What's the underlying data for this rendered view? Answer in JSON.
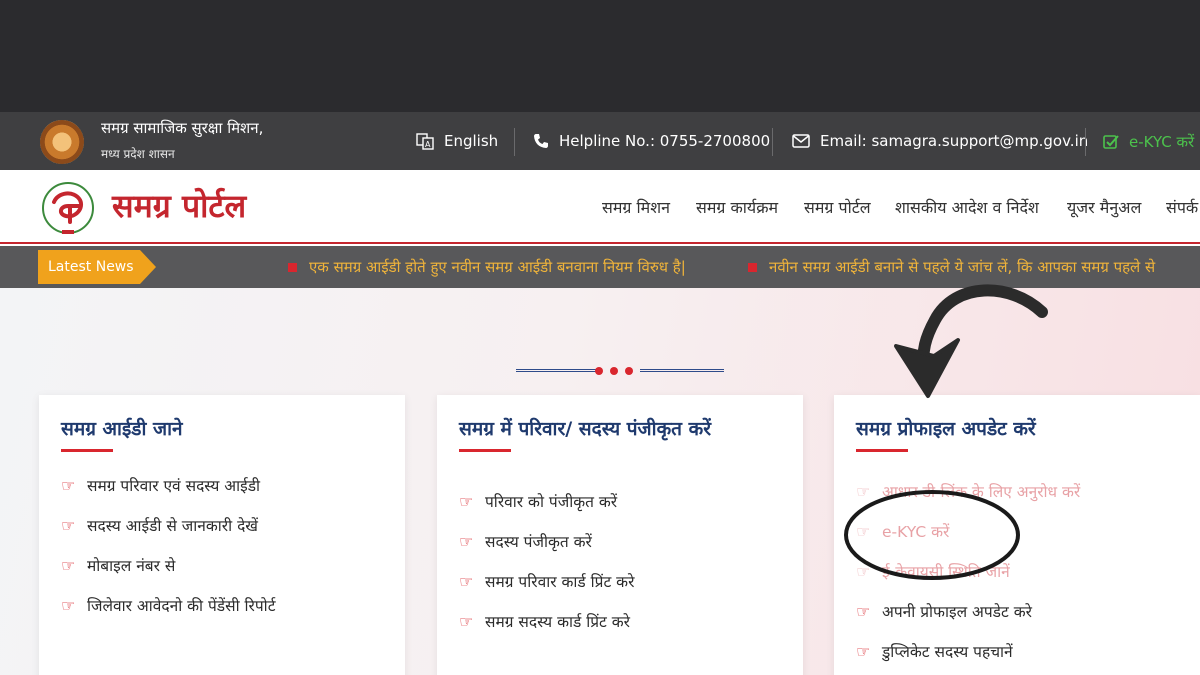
{
  "topbar": {
    "org_line1": "समग्र सामाजिक सुरक्षा मिशन,",
    "org_line2": "मध्य प्रदेश शासन",
    "language": "English",
    "helpline": "Helpline No.: 0755-2700800",
    "email": "Email: samagra.support@mp.gov.in",
    "ekyc": "e-KYC करें"
  },
  "header": {
    "brand": "समग्र पोर्टल",
    "nav": [
      "समग्र मिशन",
      "समग्र कार्यक्रम",
      "समग्र पोर्टल",
      "शासकीय आदेश व निर्देश",
      "यूजर मैनुअल",
      "संपर्क"
    ]
  },
  "ticker": {
    "label": "Latest News",
    "items": [
      "एक समग्र आईडी होते हुए नवीन समग्र आईडी बनवाना नियम विरुध है|",
      "नवीन समग्र आईडी बनाने से पहले ये जांच लें, कि आपका समग्र पहले से"
    ]
  },
  "cards": [
    {
      "title": "समग्र आईडी जाने",
      "items": [
        "समग्र परिवार एवं सदस्य आईडी",
        "सदस्य आईडी से जानकारी देखें",
        "मोबाइल नंबर से",
        "जिलेवार आवेदनो की पेंडेंसी रिपोर्ट"
      ]
    },
    {
      "title": "समग्र में परिवार/ सदस्य पंजीकृत करें",
      "items": [
        "परिवार को पंजीकृत करें",
        "सदस्य पंजीकृत करें",
        "समग्र परिवार कार्ड प्रिंट करे",
        "समग्र सदस्य कार्ड प्रिंट करे"
      ]
    },
    {
      "title": "समग्र प्रोफाइल अपडेट करें",
      "items": [
        "आधार डी-लिंक के लिए अनुरोध करें",
        "e-KYC करें",
        "ई-केवायसी स्थिति जानें",
        "अपनी प्रोफाइल अपडेट करे",
        "डुप्लिकेट सदस्य पहचानें"
      ]
    }
  ],
  "colors": {
    "brand_red": "#c4262e",
    "heading_blue": "#1f3a6e",
    "ticker_gold": "#f0b43a",
    "badge_orange": "#f0a21c",
    "ekyc_green": "#4cc24c"
  }
}
